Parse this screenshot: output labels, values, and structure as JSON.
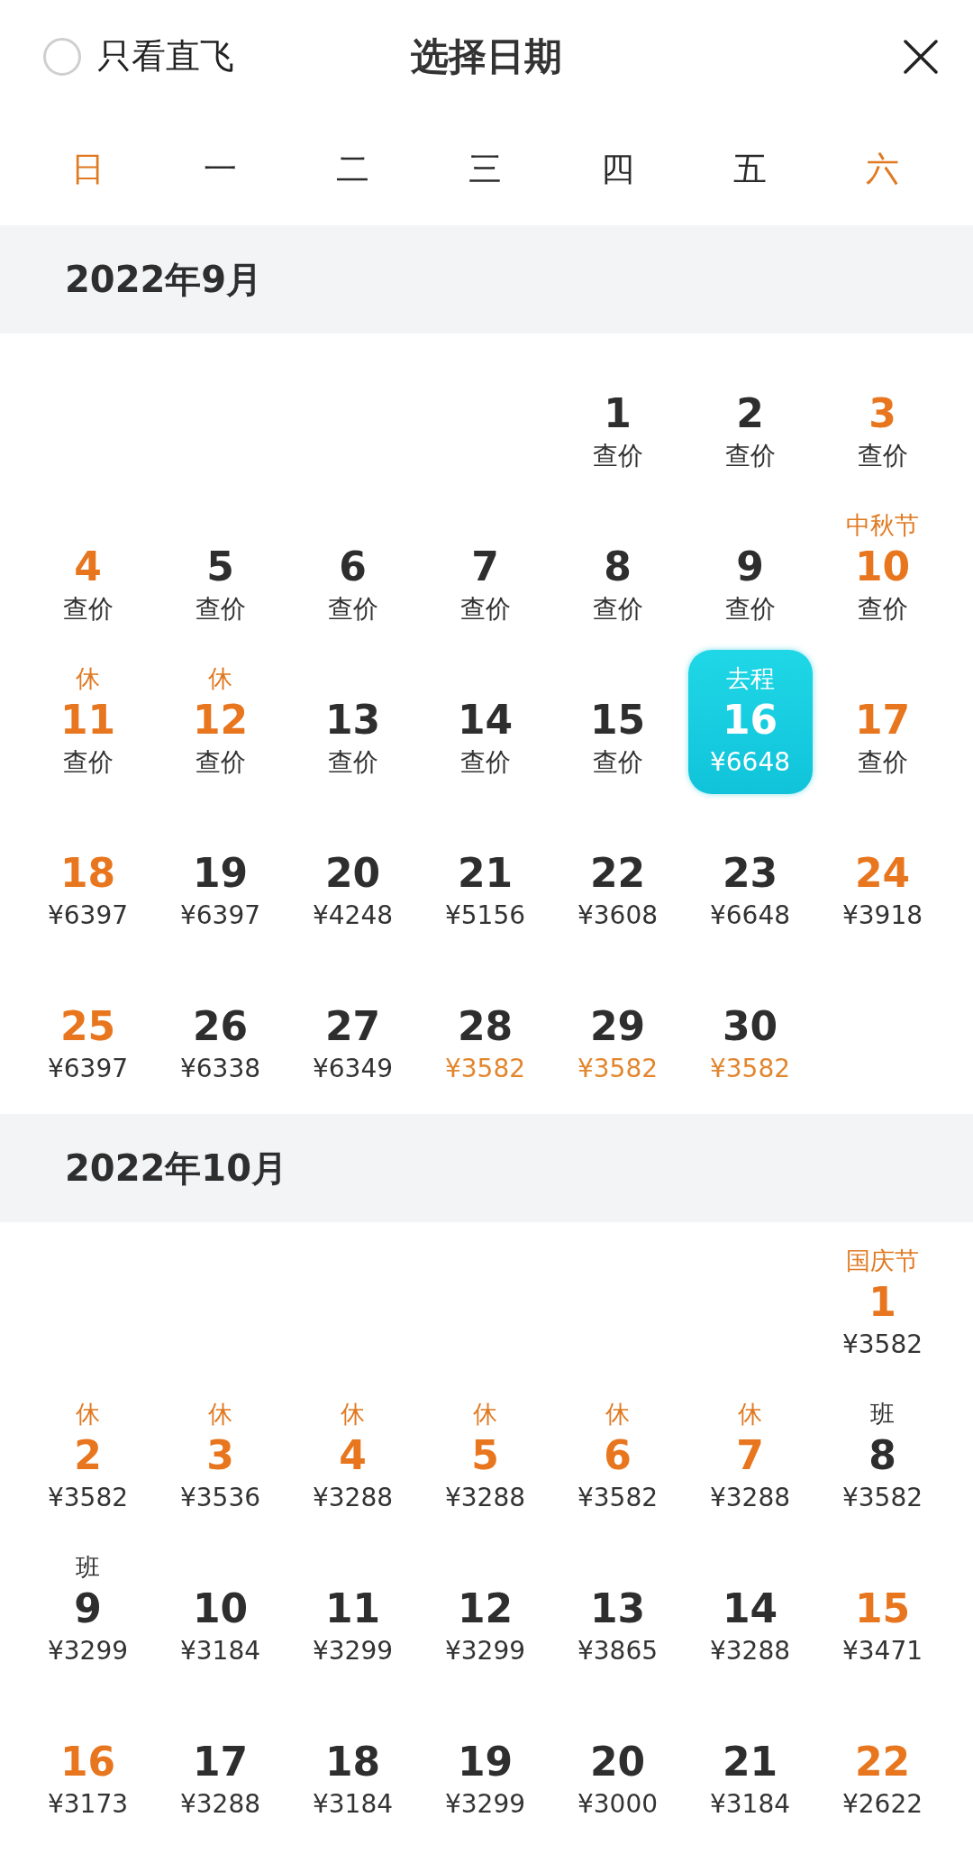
{
  "header": {
    "direct_only": {
      "label": "只看直飞",
      "checked": false
    },
    "title": "选择日期"
  },
  "weekdays": [
    {
      "label": "日",
      "weekend": true
    },
    {
      "label": "一",
      "weekend": false
    },
    {
      "label": "二",
      "weekend": false
    },
    {
      "label": "三",
      "weekend": false
    },
    {
      "label": "四",
      "weekend": false
    },
    {
      "label": "五",
      "weekend": false
    },
    {
      "label": "六",
      "weekend": true
    }
  ],
  "months": [
    {
      "title": "2022年9月",
      "weeks": [
        [
          {
            "kind": "blank"
          },
          {
            "kind": "blank"
          },
          {
            "kind": "blank"
          },
          {
            "kind": "blank"
          },
          {
            "kind": "day",
            "day": "1",
            "price": "查价",
            "highlight": false,
            "low_price": false,
            "selected": false
          },
          {
            "kind": "day",
            "day": "2",
            "price": "查价",
            "highlight": false,
            "low_price": false,
            "selected": false
          },
          {
            "kind": "day",
            "day": "3",
            "price": "查价",
            "highlight": true,
            "low_price": false,
            "selected": false
          }
        ],
        [
          {
            "kind": "day",
            "day": "4",
            "price": "查价",
            "highlight": true,
            "low_price": false,
            "selected": false
          },
          {
            "kind": "day",
            "day": "5",
            "price": "查价",
            "highlight": false,
            "low_price": false,
            "selected": false
          },
          {
            "kind": "day",
            "day": "6",
            "price": "查价",
            "highlight": false,
            "low_price": false,
            "selected": false
          },
          {
            "kind": "day",
            "day": "7",
            "price": "查价",
            "highlight": false,
            "low_price": false,
            "selected": false
          },
          {
            "kind": "day",
            "day": "8",
            "price": "查价",
            "highlight": false,
            "low_price": false,
            "selected": false
          },
          {
            "kind": "day",
            "day": "9",
            "price": "查价",
            "highlight": false,
            "low_price": false,
            "selected": false
          },
          {
            "kind": "day",
            "tag": "中秋节",
            "tag_work": false,
            "day": "10",
            "price": "查价",
            "highlight": true,
            "low_price": false,
            "selected": false
          }
        ],
        [
          {
            "kind": "day",
            "tag": "休",
            "tag_work": false,
            "day": "11",
            "price": "查价",
            "highlight": true,
            "low_price": false,
            "selected": false
          },
          {
            "kind": "day",
            "tag": "休",
            "tag_work": false,
            "day": "12",
            "price": "查价",
            "highlight": true,
            "low_price": false,
            "selected": false
          },
          {
            "kind": "day",
            "day": "13",
            "price": "查价",
            "highlight": false,
            "low_price": false,
            "selected": false
          },
          {
            "kind": "day",
            "day": "14",
            "price": "查价",
            "highlight": false,
            "low_price": false,
            "selected": false
          },
          {
            "kind": "day",
            "day": "15",
            "price": "查价",
            "highlight": false,
            "low_price": false,
            "selected": false
          },
          {
            "kind": "day",
            "tag": "去程",
            "tag_work": false,
            "day": "16",
            "price": "¥6648",
            "highlight": false,
            "low_price": false,
            "selected": true
          },
          {
            "kind": "day",
            "day": "17",
            "price": "查价",
            "highlight": true,
            "low_price": false,
            "selected": false
          }
        ],
        [
          {
            "kind": "day",
            "day": "18",
            "price": "¥6397",
            "highlight": true,
            "low_price": false,
            "selected": false
          },
          {
            "kind": "day",
            "day": "19",
            "price": "¥6397",
            "highlight": false,
            "low_price": false,
            "selected": false
          },
          {
            "kind": "day",
            "day": "20",
            "price": "¥4248",
            "highlight": false,
            "low_price": false,
            "selected": false
          },
          {
            "kind": "day",
            "day": "21",
            "price": "¥5156",
            "highlight": false,
            "low_price": false,
            "selected": false
          },
          {
            "kind": "day",
            "day": "22",
            "price": "¥3608",
            "highlight": false,
            "low_price": false,
            "selected": false
          },
          {
            "kind": "day",
            "day": "23",
            "price": "¥6648",
            "highlight": false,
            "low_price": false,
            "selected": false
          },
          {
            "kind": "day",
            "day": "24",
            "price": "¥3918",
            "highlight": true,
            "low_price": false,
            "selected": false
          }
        ],
        [
          {
            "kind": "day",
            "day": "25",
            "price": "¥6397",
            "highlight": true,
            "low_price": false,
            "selected": false
          },
          {
            "kind": "day",
            "day": "26",
            "price": "¥6338",
            "highlight": false,
            "low_price": false,
            "selected": false
          },
          {
            "kind": "day",
            "day": "27",
            "price": "¥6349",
            "highlight": false,
            "low_price": false,
            "selected": false
          },
          {
            "kind": "day",
            "day": "28",
            "price": "¥3582",
            "highlight": false,
            "low_price": true,
            "selected": false
          },
          {
            "kind": "day",
            "day": "29",
            "price": "¥3582",
            "highlight": false,
            "low_price": true,
            "selected": false
          },
          {
            "kind": "day",
            "day": "30",
            "price": "¥3582",
            "highlight": false,
            "low_price": true,
            "selected": false
          },
          {
            "kind": "blank"
          }
        ]
      ]
    },
    {
      "title": "2022年10月",
      "weeks": [
        [
          {
            "kind": "blank"
          },
          {
            "kind": "blank"
          },
          {
            "kind": "blank"
          },
          {
            "kind": "blank"
          },
          {
            "kind": "blank"
          },
          {
            "kind": "blank"
          },
          {
            "kind": "day",
            "tag": "国庆节",
            "tag_work": false,
            "day": "1",
            "price": "¥3582",
            "highlight": true,
            "low_price": false,
            "selected": false
          }
        ],
        [
          {
            "kind": "day",
            "tag": "休",
            "tag_work": false,
            "day": "2",
            "price": "¥3582",
            "highlight": true,
            "low_price": false,
            "selected": false
          },
          {
            "kind": "day",
            "tag": "休",
            "tag_work": false,
            "day": "3",
            "price": "¥3536",
            "highlight": true,
            "low_price": false,
            "selected": false
          },
          {
            "kind": "day",
            "tag": "休",
            "tag_work": false,
            "day": "4",
            "price": "¥3288",
            "highlight": true,
            "low_price": false,
            "selected": false
          },
          {
            "kind": "day",
            "tag": "休",
            "tag_work": false,
            "day": "5",
            "price": "¥3288",
            "highlight": true,
            "low_price": false,
            "selected": false
          },
          {
            "kind": "day",
            "tag": "休",
            "tag_work": false,
            "day": "6",
            "price": "¥3582",
            "highlight": true,
            "low_price": false,
            "selected": false
          },
          {
            "kind": "day",
            "tag": "休",
            "tag_work": false,
            "day": "7",
            "price": "¥3288",
            "highlight": true,
            "low_price": false,
            "selected": false
          },
          {
            "kind": "day",
            "tag": "班",
            "tag_work": true,
            "day": "8",
            "price": "¥3582",
            "highlight": false,
            "low_price": false,
            "selected": false
          }
        ],
        [
          {
            "kind": "day",
            "tag": "班",
            "tag_work": true,
            "day": "9",
            "price": "¥3299",
            "highlight": false,
            "low_price": false,
            "selected": false
          },
          {
            "kind": "day",
            "day": "10",
            "price": "¥3184",
            "highlight": false,
            "low_price": false,
            "selected": false
          },
          {
            "kind": "day",
            "day": "11",
            "price": "¥3299",
            "highlight": false,
            "low_price": false,
            "selected": false
          },
          {
            "kind": "day",
            "day": "12",
            "price": "¥3299",
            "highlight": false,
            "low_price": false,
            "selected": false
          },
          {
            "kind": "day",
            "day": "13",
            "price": "¥3865",
            "highlight": false,
            "low_price": false,
            "selected": false
          },
          {
            "kind": "day",
            "day": "14",
            "price": "¥3288",
            "highlight": false,
            "low_price": false,
            "selected": false
          },
          {
            "kind": "day",
            "day": "15",
            "price": "¥3471",
            "highlight": true,
            "low_price": false,
            "selected": false
          }
        ],
        [
          {
            "kind": "day",
            "day": "16",
            "price": "¥3173",
            "highlight": true,
            "low_price": false,
            "selected": false
          },
          {
            "kind": "day",
            "day": "17",
            "price": "¥3288",
            "highlight": false,
            "low_price": false,
            "selected": false
          },
          {
            "kind": "day",
            "day": "18",
            "price": "¥3184",
            "highlight": false,
            "low_price": false,
            "selected": false
          },
          {
            "kind": "day",
            "day": "19",
            "price": "¥3299",
            "highlight": false,
            "low_price": false,
            "selected": false
          },
          {
            "kind": "day",
            "day": "20",
            "price": "¥3000",
            "highlight": false,
            "low_price": false,
            "selected": false
          },
          {
            "kind": "day",
            "day": "21",
            "price": "¥3184",
            "highlight": false,
            "low_price": false,
            "selected": false
          },
          {
            "kind": "day",
            "day": "22",
            "price": "¥2622",
            "highlight": true,
            "low_price": false,
            "selected": false
          }
        ]
      ]
    }
  ]
}
